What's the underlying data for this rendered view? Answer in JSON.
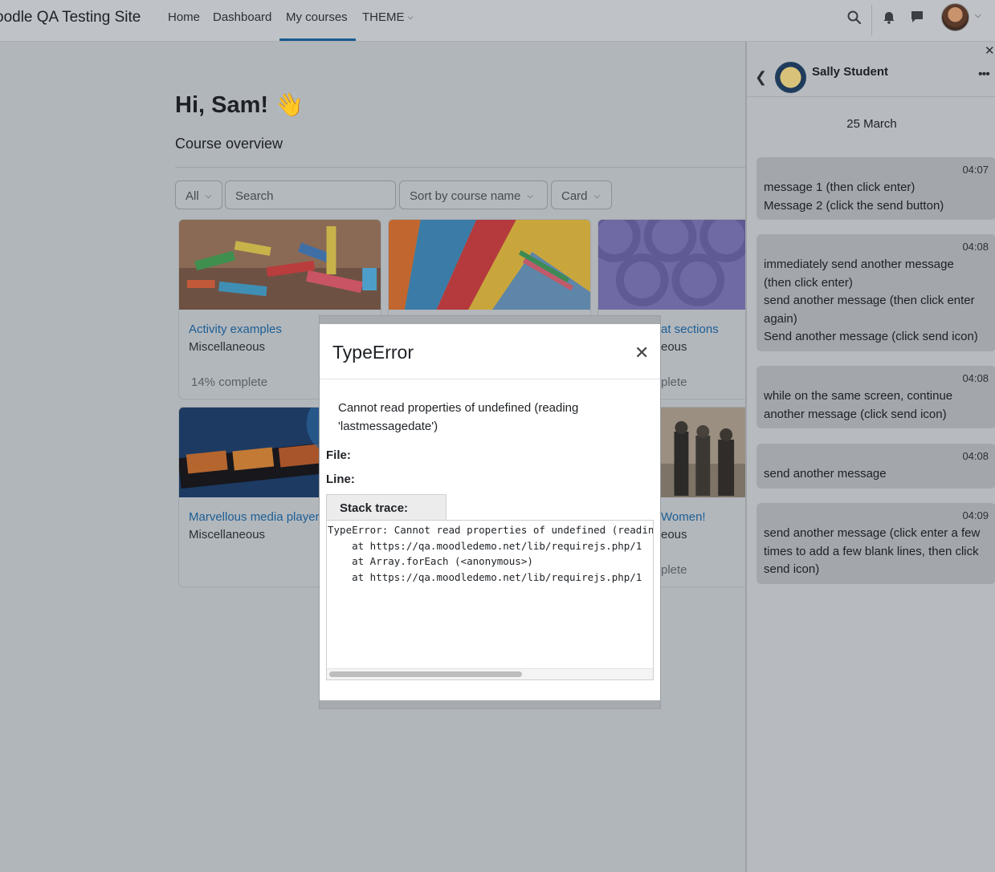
{
  "navbar": {
    "site_name": "oodle QA Testing Site",
    "links": [
      "Home",
      "Dashboard",
      "My courses",
      "THEME"
    ],
    "active_link": "My courses",
    "icons": [
      "search-icon",
      "bell-icon",
      "chat-icon",
      "chevron-down-icon"
    ]
  },
  "main": {
    "greeting": "Hi, Sam! 👋",
    "section_title": "Course overview",
    "filters": {
      "grouping": "All",
      "search_placeholder": "Search",
      "sort": "Sort by course name",
      "view": "Card"
    },
    "courses": [
      {
        "name": "Activity examples",
        "category": "Miscellaneous",
        "progress": "14% complete"
      },
      {
        "name": "",
        "category": "",
        "progress": ""
      },
      {
        "name": "at sections",
        "category": "eous",
        "progress": "plete"
      },
      {
        "name": "Marvellous media player",
        "category": "Miscellaneous",
        "progress": ""
      },
      {
        "name": "Women!",
        "category": "eous",
        "progress": "plete"
      }
    ]
  },
  "drawer": {
    "contact_name": "Sally Student",
    "date": "25 March",
    "messages": [
      {
        "time": "04:07",
        "lines": [
          "message 1 (then click enter)",
          "Message 2 (click the send button)"
        ]
      },
      {
        "time": "04:08",
        "lines": [
          "immediately send another message",
          "(then click enter)",
          "send another message (then click enter",
          "again)",
          "Send another message (click send icon)"
        ]
      },
      {
        "time": "04:08",
        "lines": [
          "while on the same screen, continue",
          "another message (click send icon)"
        ]
      },
      {
        "time": "04:08",
        "lines": [
          "send another message"
        ]
      },
      {
        "time": "04:09",
        "lines": [
          "send another message (click enter a few",
          "times to add a few blank lines, then click",
          "send icon)"
        ]
      }
    ]
  },
  "modal": {
    "title": "TypeError",
    "message": "Cannot read properties of undefined (reading 'lastmessagedate')",
    "file_label": "File:",
    "line_label": "Line:",
    "stack_tab": "Stack trace:",
    "stack_trace": "TypeError: Cannot read properties of undefined (reading 'lastmessagedate')\n    at https://qa.moodledemo.net/lib/requirejs.php/1\n    at Array.forEach (<anonymous>)\n    at https://qa.moodledemo.net/lib/requirejs.php/1"
  }
}
